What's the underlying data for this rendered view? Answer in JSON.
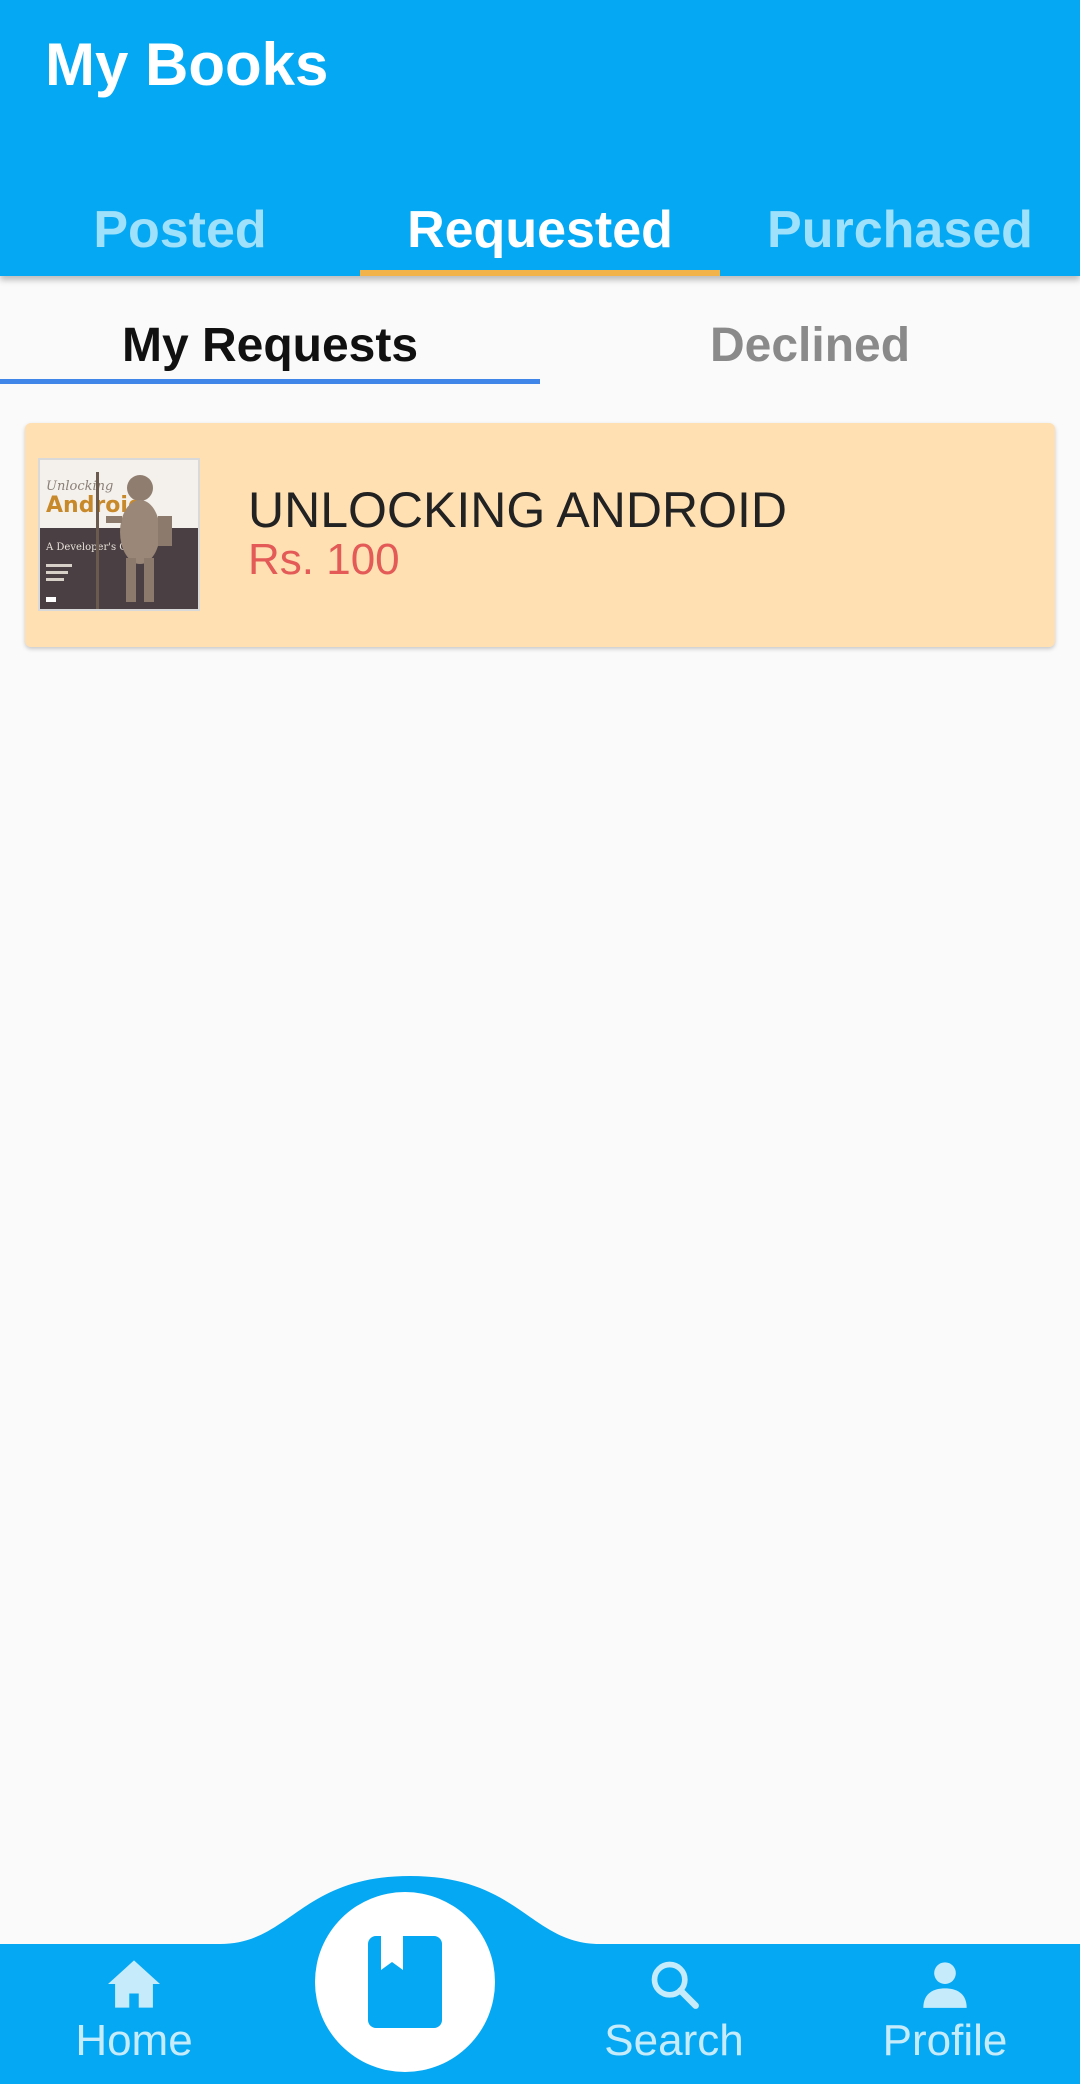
{
  "appbar": {
    "title": "My Books"
  },
  "tabs": [
    {
      "label": "Posted",
      "active": false
    },
    {
      "label": "Requested",
      "active": true
    },
    {
      "label": "Purchased",
      "active": false
    }
  ],
  "subtabs": [
    {
      "label": "My Requests",
      "active": true
    },
    {
      "label": "Declined",
      "active": false
    }
  ],
  "requests": [
    {
      "title": "UNLOCKING ANDROID",
      "price": "Rs. 100",
      "cover": {
        "top_text": "Unlocking",
        "main_text": "Android",
        "subtitle": "A Developer's Guide"
      }
    }
  ],
  "bottom_nav": {
    "home": {
      "label": "Home",
      "icon": "home-icon"
    },
    "center": {
      "icon": "book-icon"
    },
    "search": {
      "label": "Search",
      "icon": "search-icon"
    },
    "profile": {
      "label": "Profile",
      "icon": "person-icon"
    }
  },
  "colors": {
    "primary": "#05a8f2",
    "tab_indicator": "#f2b34a",
    "subtab_indicator": "#3f86e8",
    "card_bg": "#ffe0b3",
    "price": "#e35a57"
  }
}
